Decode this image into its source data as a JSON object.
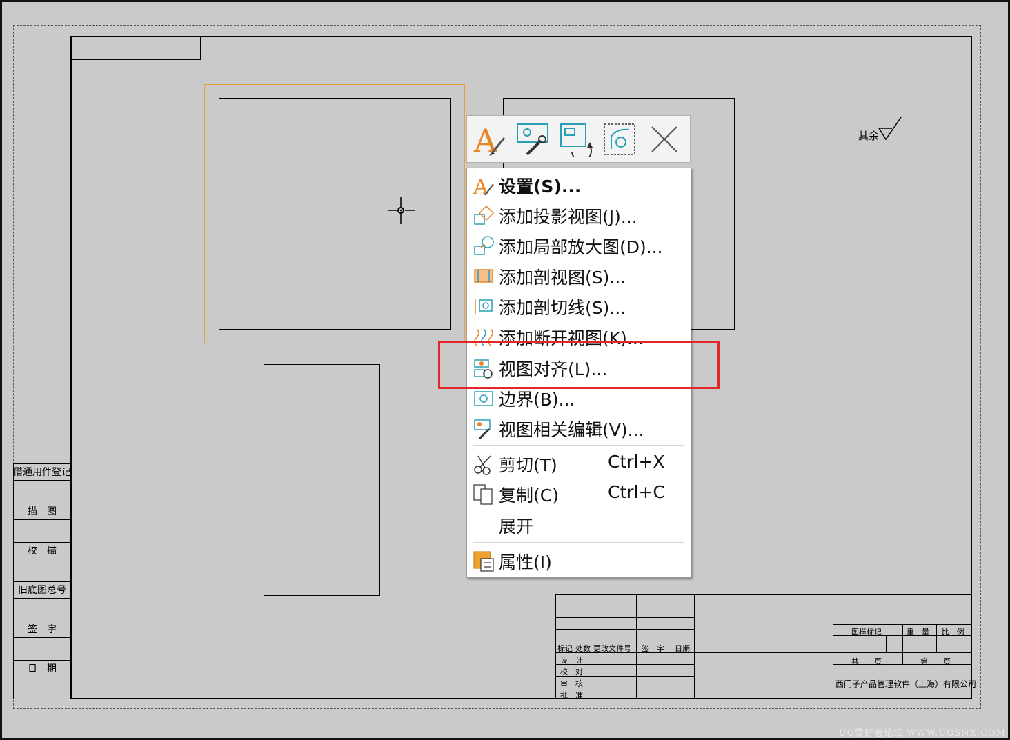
{
  "toolbar": {
    "buttons": [
      {
        "name": "settings-tool-icon"
      },
      {
        "name": "view-edit-tool-icon"
      },
      {
        "name": "view-update-tool-icon"
      },
      {
        "name": "view-boundary-tool-icon"
      },
      {
        "name": "close-icon"
      }
    ]
  },
  "menu": {
    "items": [
      {
        "label": "设置(S)...",
        "icon": "settings-icon"
      },
      {
        "label": "添加投影视图(J)...",
        "icon": "projected-view-icon"
      },
      {
        "label": "添加局部放大图(D)...",
        "icon": "detail-view-icon"
      },
      {
        "label": "添加剖视图(S)...",
        "icon": "section-view-icon"
      },
      {
        "label": "添加剖切线(S)...",
        "icon": "section-line-icon"
      },
      {
        "label": "添加断开视图(K)...",
        "icon": "break-view-icon"
      },
      {
        "label": "视图对齐(L)...",
        "icon": "view-align-icon"
      },
      {
        "label": "边界(B)...",
        "icon": "boundary-icon"
      },
      {
        "label": "视图相关编辑(V)...",
        "icon": "view-dependent-edit-icon"
      },
      {
        "label": "剪切(T)",
        "shortcut": "Ctrl+X",
        "icon": "scissors-icon"
      },
      {
        "label": "复制(C)",
        "shortcut": "Ctrl+C",
        "icon": "copy-icon"
      },
      {
        "label": "展开",
        "icon": ""
      },
      {
        "label": "属性(I)",
        "icon": "properties-icon"
      }
    ]
  },
  "drawing": {
    "roughness_note": "其余",
    "left_table": [
      "借通用件登记",
      "描　图",
      "校　描",
      "旧底图总号",
      "签　字",
      "日　期"
    ],
    "title_block": {
      "rev_headers": [
        "标记",
        "处数",
        "更改文件号",
        "签　字",
        "日期"
      ],
      "roles": [
        "设　计",
        "校　对",
        "审　核",
        "批　准"
      ],
      "pattern_mark": "图样标记",
      "weight": "重　量",
      "scale": "比　例",
      "total_pages": "共　　页",
      "page_no": "第　　页",
      "company": "西门子产品管理软件（上海）有限公司"
    }
  },
  "watermark": "UG爱好者论坛 WWW.UGSNX.COM",
  "colors": {
    "highlight": "#e3262a",
    "accent_orange": "#e8862a",
    "accent_teal": "#2a9fb5"
  }
}
